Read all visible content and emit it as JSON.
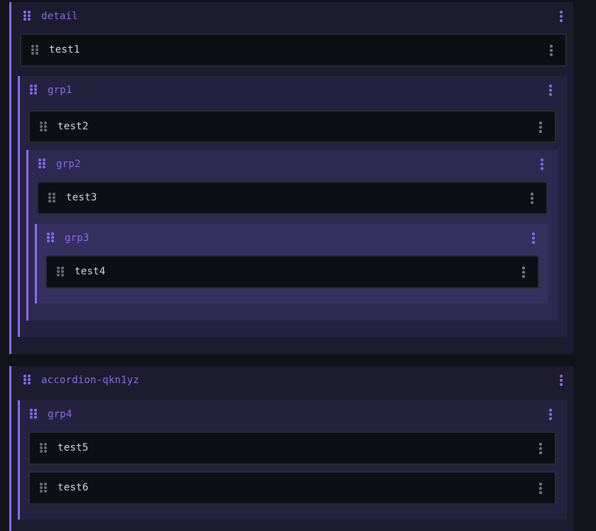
{
  "groups": {
    "detail": {
      "title": "detail"
    },
    "grp1": {
      "title": "grp1"
    },
    "grp2": {
      "title": "grp2"
    },
    "grp3": {
      "title": "grp3"
    },
    "accordion": {
      "title": "accordion-qkn1yz"
    },
    "grp4": {
      "title": "grp4"
    }
  },
  "fields": {
    "test1": {
      "label": "test1"
    },
    "test2": {
      "label": "test2"
    },
    "test3": {
      "label": "test3"
    },
    "test4": {
      "label": "test4"
    },
    "test5": {
      "label": "test5"
    },
    "test6": {
      "label": "test6"
    }
  },
  "icons": {
    "drag_handle": "drag-handle-icon",
    "more_menu": "more-vertical-icon"
  },
  "colors": {
    "accent": "#8b6cf0",
    "page_bg": "#12131a",
    "field_bg": "#0e0f14",
    "field_text": "#d8d8e0"
  }
}
